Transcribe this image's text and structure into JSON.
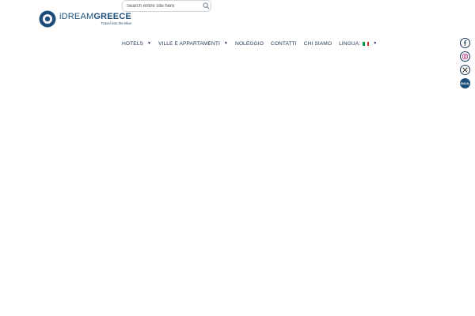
{
  "brand": {
    "word_light": "iDREAM",
    "word_bold": "GREECE",
    "tagline": "Travel into the Blue",
    "color": "#1d4f7a"
  },
  "search": {
    "placeholder": "Search entire site here",
    "value": "",
    "icon": "search-icon"
  },
  "nav": {
    "items": [
      {
        "label": "HOTELS",
        "has_dropdown": true
      },
      {
        "label": "VILLE E APPARTAMENTI",
        "has_dropdown": true
      },
      {
        "label": "NOLEGGIO",
        "has_dropdown": false
      },
      {
        "label": "CONTATTI",
        "has_dropdown": false
      },
      {
        "label": "CHI SIAMO",
        "has_dropdown": false
      },
      {
        "label": "LINGUA:",
        "has_dropdown": true,
        "flag": "italy-flag-icon"
      }
    ],
    "caret_glyph": "▼"
  },
  "social": {
    "items": [
      {
        "icon": "facebook-icon"
      },
      {
        "icon": "instagram-icon"
      },
      {
        "icon": "x-twitter-icon"
      },
      {
        "icon": "email-icon",
        "label": "EMAIL"
      }
    ]
  },
  "colors": {
    "text": "#1d3557",
    "accent": "#1d4f7a",
    "flag_green": "#009246",
    "flag_white": "#ffffff",
    "flag_red": "#ce2b37"
  }
}
